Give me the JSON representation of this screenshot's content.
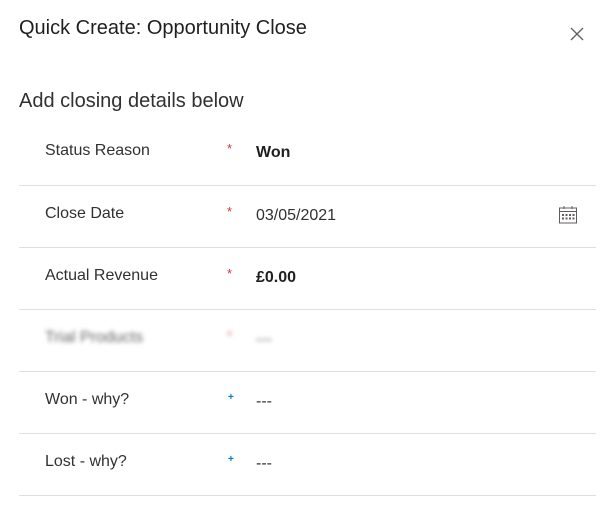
{
  "dialog": {
    "title": "Quick Create: Opportunity Close",
    "close_icon": "close-icon",
    "section_title": "Add closing details below"
  },
  "fields": [
    {
      "label": "Status Reason",
      "marker": "*",
      "marker_type": "required",
      "value": "Won"
    },
    {
      "label": "Close Date",
      "marker": "*",
      "marker_type": "required",
      "value": "03/05/2021",
      "icon": "calendar-icon"
    },
    {
      "label": "Actual Revenue",
      "marker": "*",
      "marker_type": "required",
      "value": "£0.00"
    },
    {
      "label": "Trial Products",
      "marker": "*",
      "marker_type": "required",
      "value": "---",
      "blurred": true
    },
    {
      "label": "Won - why?",
      "marker": "+",
      "marker_type": "recommended",
      "value": "---"
    },
    {
      "label": "Lost - why?",
      "marker": "+",
      "marker_type": "recommended",
      "value": "---"
    }
  ],
  "colors": {
    "required": "#d13438",
    "recommended": "#0078d4",
    "divider": "#e1dfdd"
  }
}
